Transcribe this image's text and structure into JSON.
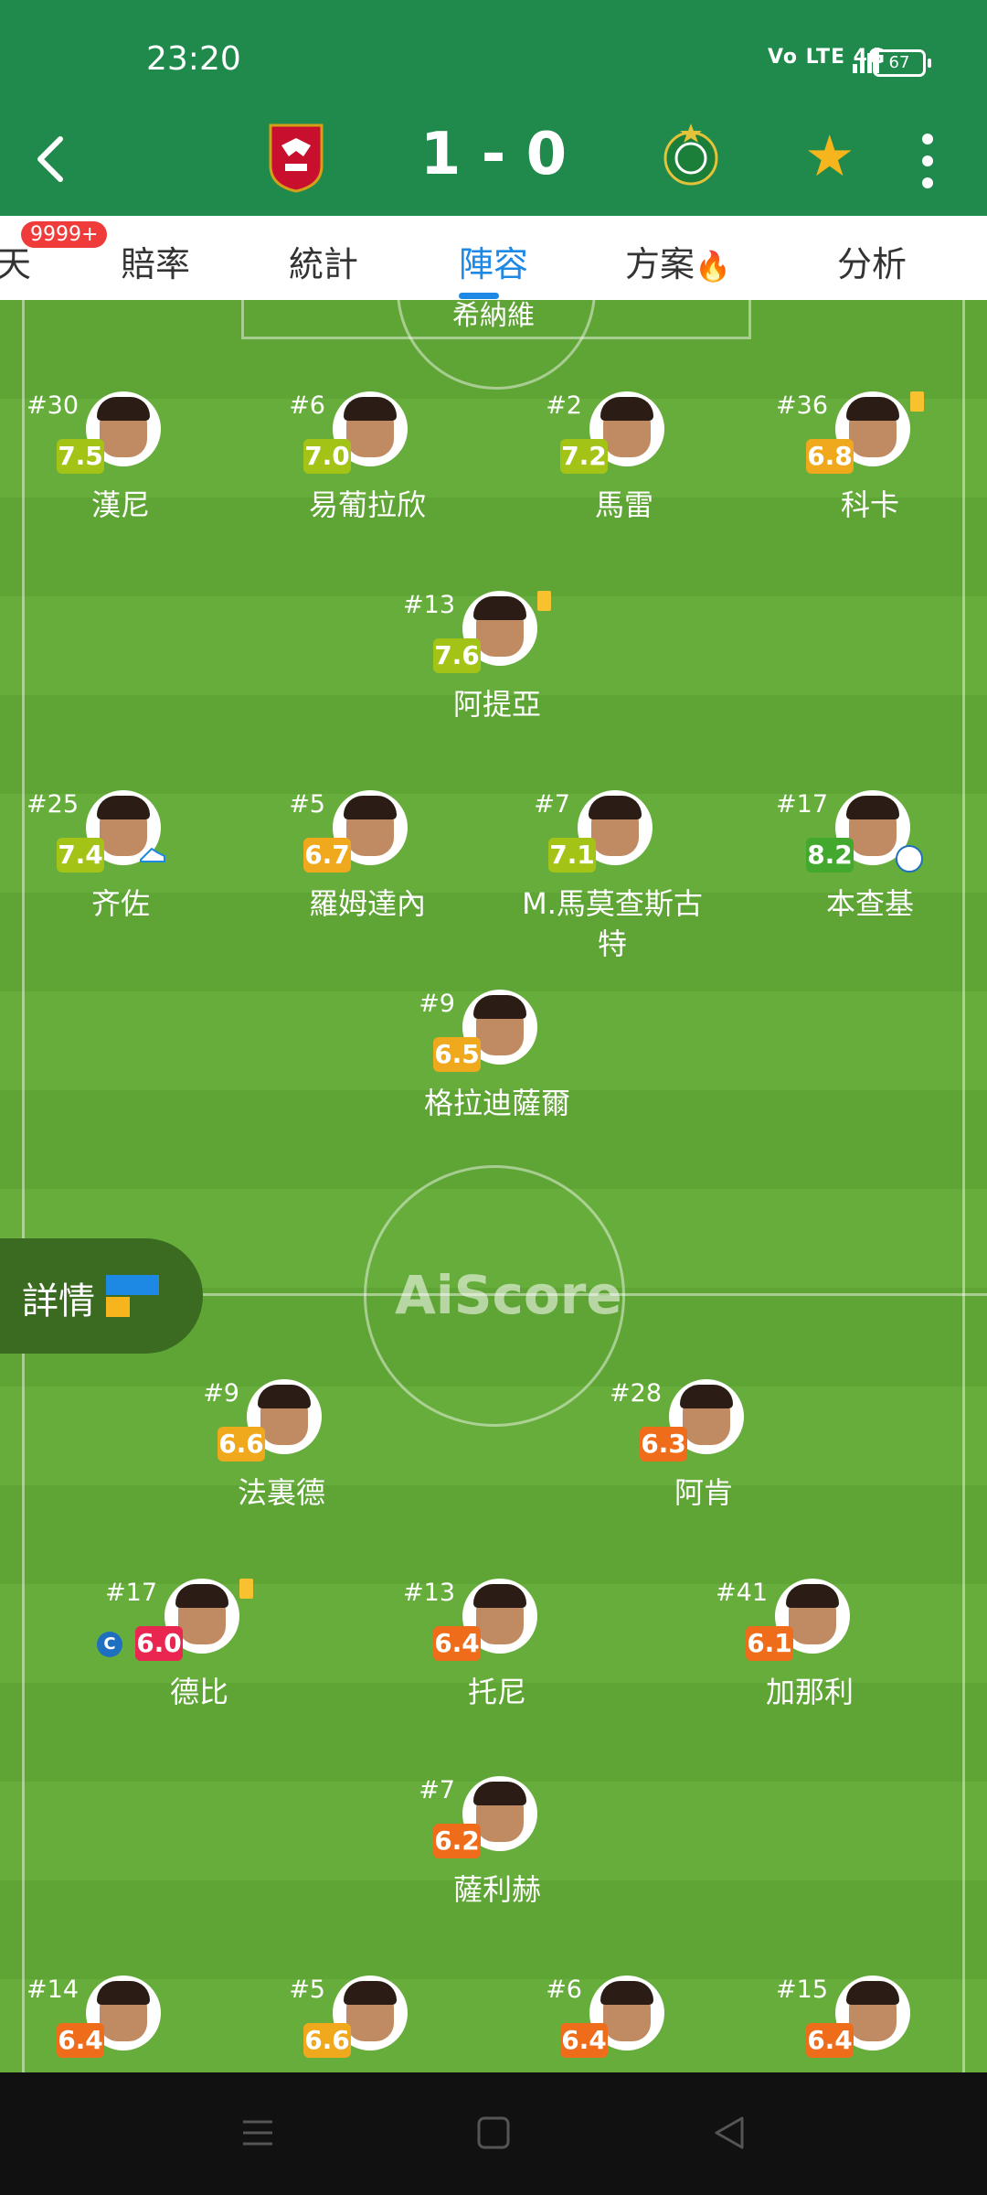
{
  "status": {
    "time": "23:20",
    "network": "Vo LTE 4G",
    "battery": "67"
  },
  "match": {
    "score": "1 - 0"
  },
  "tabs": {
    "items": [
      {
        "label": "天",
        "active": false
      },
      {
        "label": "賠率",
        "active": false
      },
      {
        "label": "統計",
        "active": false
      },
      {
        "label": "陣容",
        "active": true
      },
      {
        "label": "方案",
        "active": false
      },
      {
        "label": "分析",
        "active": false
      }
    ],
    "badge": "9999+",
    "hot_icon": "🔥"
  },
  "field": {
    "top_cut_name": "希納維",
    "watermark": "AiScore",
    "detail_label": "詳情"
  },
  "players": [
    {
      "number": "#30",
      "rating": "7.5",
      "name": "漢尼",
      "rating_color": "#a3c417"
    },
    {
      "number": "#6",
      "rating": "7.0",
      "name": "易葡拉欣",
      "rating_color": "#a3c417"
    },
    {
      "number": "#2",
      "rating": "7.2",
      "name": "馬雷",
      "rating_color": "#a3c417"
    },
    {
      "number": "#36",
      "rating": "6.8",
      "name": "科卡",
      "rating_color": "#f0a81c",
      "card": "yellow"
    },
    {
      "number": "#13",
      "rating": "7.6",
      "name": "阿提亞",
      "rating_color": "#a3c417",
      "card": "yellow"
    },
    {
      "number": "#25",
      "rating": "7.4",
      "name": "齐佐",
      "rating_color": "#a3c417",
      "icon": "boot-icon"
    },
    {
      "number": "#5",
      "rating": "6.7",
      "name": "羅姆達內",
      "rating_color": "#f0a81c"
    },
    {
      "number": "#7",
      "rating": "7.1",
      "name": "M.馬莫查斯古\n特",
      "rating_color": "#a3c417"
    },
    {
      "number": "#17",
      "rating": "8.2",
      "name": "本查基",
      "rating_color": "#43a82e",
      "icon": "ball-icon"
    },
    {
      "number": "#9",
      "rating": "6.5",
      "name": "格拉迪薩爾",
      "rating_color": "#f0a81c"
    },
    {
      "number": "#9",
      "rating": "6.6",
      "name": "法裏德",
      "rating_color": "#f0a81c"
    },
    {
      "number": "#28",
      "rating": "6.3",
      "name": "阿肯",
      "rating_color": "#ef6c1a"
    },
    {
      "number": "#17",
      "rating": "6.0",
      "name": "德比",
      "rating_color": "#e8264f",
      "card": "yellow",
      "captain": "C"
    },
    {
      "number": "#13",
      "rating": "6.4",
      "name": "托尼",
      "rating_color": "#ef6c1a"
    },
    {
      "number": "#41",
      "rating": "6.1",
      "name": "加那利",
      "rating_color": "#ef6c1a"
    },
    {
      "number": "#7",
      "rating": "6.2",
      "name": "薩利赫",
      "rating_color": "#ef6c1a"
    },
    {
      "number": "#14",
      "rating": "6.4",
      "name": "",
      "rating_color": "#ef6c1a"
    },
    {
      "number": "#5",
      "rating": "6.6",
      "name": "",
      "rating_color": "#f0a81c"
    },
    {
      "number": "#6",
      "rating": "6.4",
      "name": "",
      "rating_color": "#ef6c1a"
    },
    {
      "number": "#15",
      "rating": "6.4",
      "name": "",
      "rating_color": "#ef6c1a"
    }
  ],
  "colors": {
    "header": "#1f8a4c",
    "accent": "#1e88e5",
    "star": "#f6b51c"
  }
}
